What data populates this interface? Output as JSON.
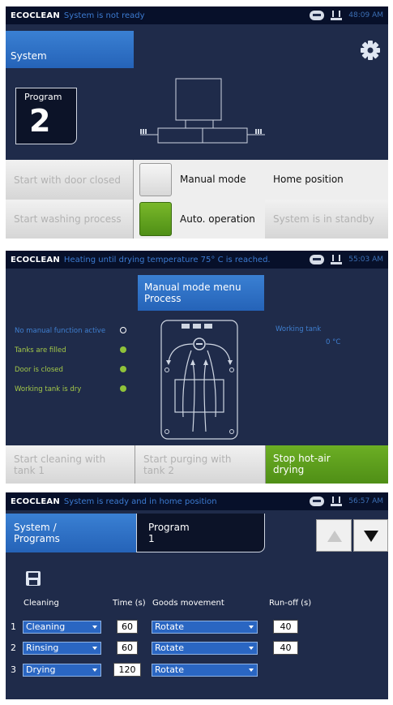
{
  "brand": "ECOCLEAN",
  "colors": {
    "accent_blue": "#2f73c9",
    "active_green": "#64a81e",
    "status_green": "#a4c948",
    "panel_bg": "#1f2b4a"
  },
  "screen1": {
    "status_message": "System is not ready",
    "time": "48:09 AM",
    "tab_system": "System",
    "program_label": "Program",
    "program_number": "2",
    "settings_icon": "gear-icon",
    "buttons": {
      "start_door_closed": "Start with door closed",
      "manual_mode": "Manual mode",
      "home_position": "Home position",
      "start_washing": "Start washing process",
      "auto_operation": "Auto. operation",
      "standby": "System is in standby"
    }
  },
  "screen2": {
    "status_message": "Heating until drying temperature 75° C is reached.",
    "time": "55:03 AM",
    "menu_title_line1": "Manual mode menu",
    "menu_title_line2": "Process",
    "indicators": [
      {
        "label": "No manual function active",
        "state": "inactive"
      },
      {
        "label": "Tanks are filled",
        "state": "active"
      },
      {
        "label": "Door is closed",
        "state": "active"
      },
      {
        "label": "Working tank is dry",
        "state": "active"
      }
    ],
    "working_tank_label": "Working tank",
    "working_tank_value": "0 °C",
    "buttons": {
      "start_cleaning_line1": "Start cleaning with",
      "start_cleaning_line2": "tank 1",
      "start_purging_line1": "Start purging with",
      "start_purging_line2": "tank 2",
      "stop_drying_line1": "Stop hot-air",
      "stop_drying_line2": "drying"
    }
  },
  "screen3": {
    "status_message": "System is ready and in home position",
    "time": "56:57 AM",
    "tab_system_line1": "System /",
    "tab_system_line2": "Programs",
    "program_label": "Program",
    "program_number": "1",
    "save_icon": "save-icon",
    "headers": {
      "cleaning": "Cleaning",
      "time": "Time (s)",
      "goods": "Goods movement",
      "runoff": "Run-off (s)"
    },
    "rows": [
      {
        "num": "1",
        "step": "Cleaning",
        "time": "60",
        "movement": "Rotate",
        "runoff": "40"
      },
      {
        "num": "2",
        "step": "Rinsing",
        "time": "60",
        "movement": "Rotate",
        "runoff": "40"
      },
      {
        "num": "3",
        "step": "Drying",
        "time": "120",
        "movement": "Rotate",
        "runoff": ""
      }
    ]
  }
}
